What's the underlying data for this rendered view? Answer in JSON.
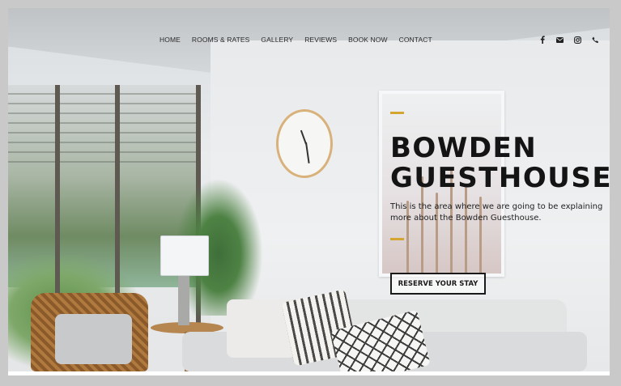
{
  "nav": {
    "links": [
      "HOME",
      "ROOMS & RATES",
      "GALLERY",
      "REVIEWS",
      "BOOK NOW",
      "CONTACT"
    ],
    "social_icons": [
      "facebook-icon",
      "email-icon",
      "instagram-icon",
      "phone-icon"
    ]
  },
  "hero": {
    "title_line1": "BOWDEN",
    "title_line2": "GUESTHOUSE",
    "description": "This is the area where we are going to be explaining more about the Bowden Guesthouse.",
    "cta_label": "RESERVE YOUR STAY",
    "accent_color": "#d5a531"
  }
}
